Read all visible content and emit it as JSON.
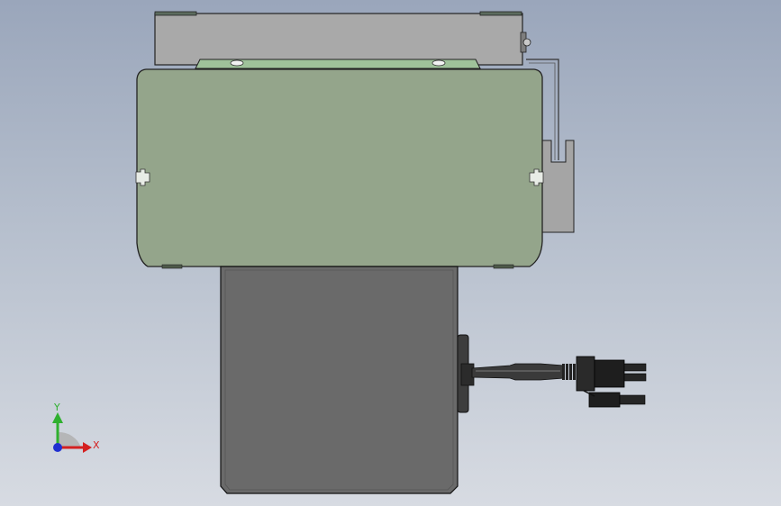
{
  "viewport": {
    "background_top": "#9aa6bb",
    "background_bottom": "#d7dbe2"
  },
  "model": {
    "top_plate_color": "#a9a9a9",
    "cover_color": "#94a58b",
    "clamp_strip_color": "#9fc29a",
    "lower_housing_color": "#6a6a6a",
    "bracket_color": "#a5a5a5",
    "cable_color": "#3a3a3a",
    "connector_color": "#1e1e1e"
  },
  "triad": {
    "y_label": "Y",
    "x_label": "X",
    "y_color": "#2fb02f",
    "x_color": "#d42020",
    "z_color": "#2030d0"
  }
}
